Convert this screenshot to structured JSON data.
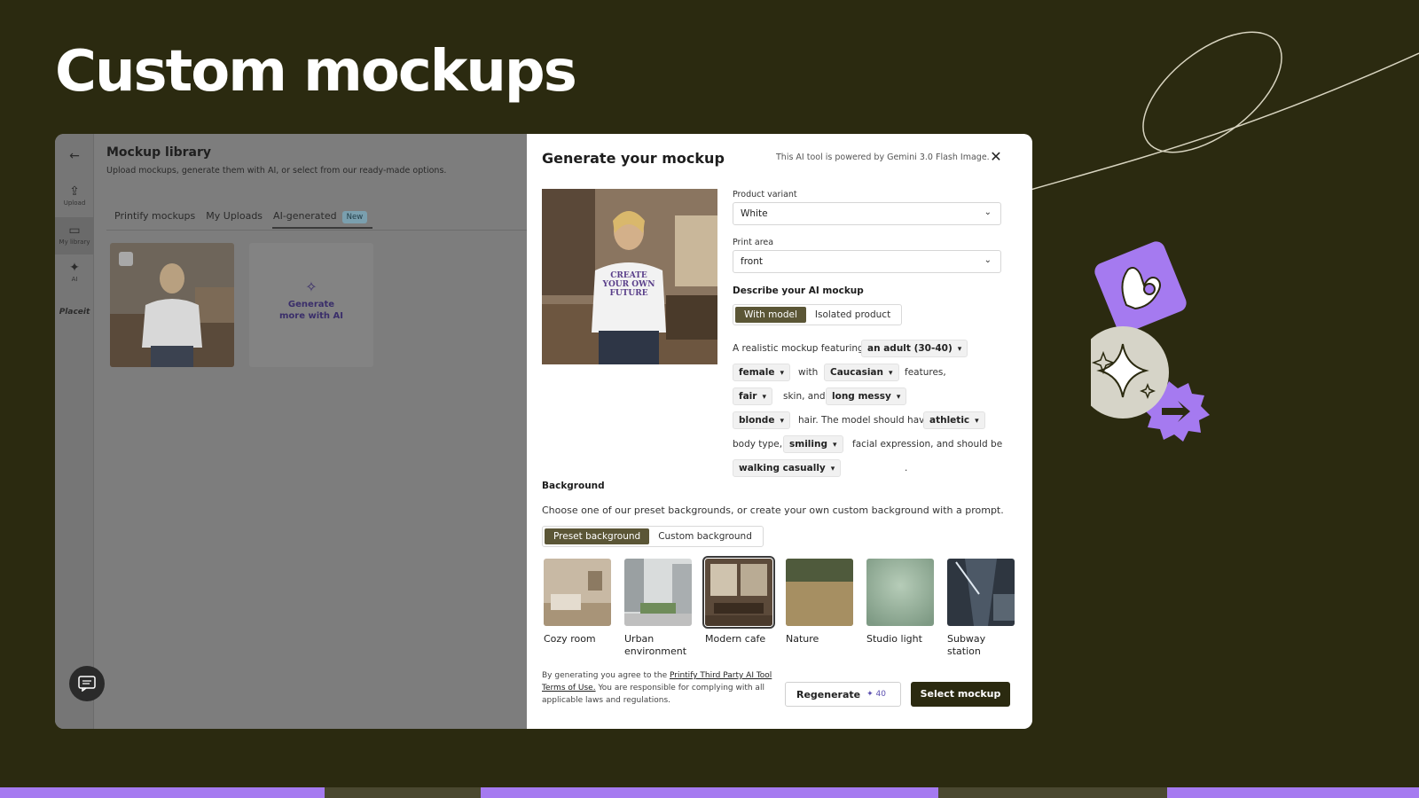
{
  "headline": "Custom mockups",
  "colors": {
    "background": "#2b2a10",
    "accent_purple": "#a57af0",
    "modal_bg": "#ffffff",
    "primary_button": "#2b2a10",
    "segment_active": "#5b5636"
  },
  "library": {
    "back_icon": "arrow-left-icon",
    "title": "Mockup library",
    "subtitle": "Upload mockups, generate them with AI, or select from our ready-made options.",
    "rail": [
      {
        "icon": "upload-icon",
        "label": "Upload"
      },
      {
        "icon": "folder-icon",
        "label": "My library"
      },
      {
        "icon": "sparkle-icon",
        "label": "AI"
      },
      {
        "icon": "placeit-logo",
        "label": "Placeit"
      }
    ],
    "tabs": [
      "Printify mockups",
      "My Uploads",
      "AI-generated"
    ],
    "new_badge": "New",
    "generate_more": "Generate more with AI"
  },
  "modal": {
    "title": "Generate your mockup",
    "powered_by": "This AI tool is powered by Gemini 3.0 Flash Image.",
    "product_variant_label": "Product variant",
    "product_variant_value": "White",
    "print_area_label": "Print area",
    "print_area_value": "front",
    "describe_title": "Describe your AI mockup",
    "mode_options": [
      "With model",
      "Isolated product"
    ],
    "sentence": {
      "t1": "A realistic mockup featuring",
      "age": "an adult (30-40)",
      "gender": "female",
      "t2": "with",
      "ethnicity": "Caucasian",
      "t3": "features,",
      "skin": "fair",
      "t4": "skin, and",
      "hair_style": "long messy",
      "hair_color": "blonde",
      "t5": "hair. The model should have",
      "body": "athletic",
      "t6": "body type,",
      "expression": "smiling",
      "t7": "facial expression, and should be",
      "action": "walking casually",
      "t8": "."
    },
    "background_title": "Background",
    "background_desc": "Choose one of our preset backgrounds, or create your own custom background with a prompt.",
    "background_modes": [
      "Preset background",
      "Custom background"
    ],
    "backgrounds": [
      "Cozy room",
      "Urban environment",
      "Modern cafe",
      "Nature",
      "Studio light",
      "Subway station"
    ],
    "selected_background": "Modern cafe",
    "legal_prefix": "By generating you agree to the",
    "legal_link": "Printify Third Party AI Tool Terms of Use.",
    "legal_suffix": "You are responsible for complying with all applicable laws and regulations.",
    "regenerate_label": "Regenerate",
    "regenerate_credits": "40",
    "select_label": "Select mockup",
    "shirt_print": "CREATE YOUR OWN FUTURE"
  }
}
